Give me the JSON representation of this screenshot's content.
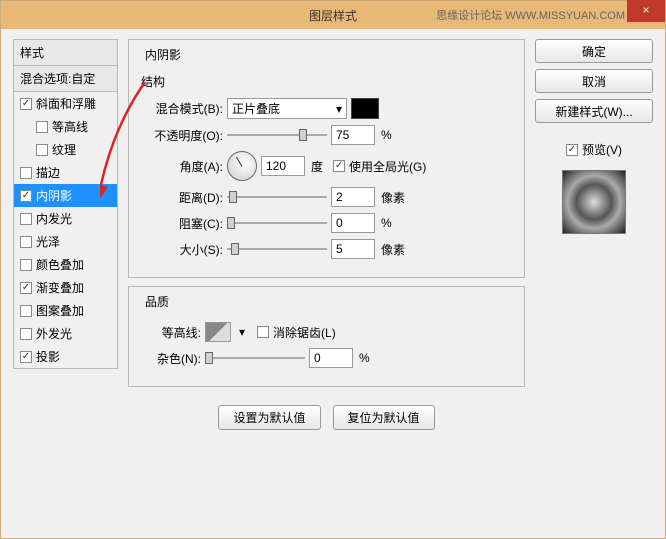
{
  "title": "图层样式",
  "watermark": "思缘设计论坛 WWW.MISSYUAN.COM",
  "left": {
    "header": "样式",
    "sub": "混合选项:自定",
    "items": [
      {
        "label": "斜面和浮雕",
        "checked": true,
        "indent": false
      },
      {
        "label": "等高线",
        "checked": false,
        "indent": true
      },
      {
        "label": "纹理",
        "checked": false,
        "indent": true
      },
      {
        "label": "描边",
        "checked": false,
        "indent": false
      },
      {
        "label": "内阴影",
        "checked": true,
        "indent": false,
        "selected": true
      },
      {
        "label": "内发光",
        "checked": false,
        "indent": false
      },
      {
        "label": "光泽",
        "checked": false,
        "indent": false
      },
      {
        "label": "颜色叠加",
        "checked": false,
        "indent": false
      },
      {
        "label": "渐变叠加",
        "checked": true,
        "indent": false
      },
      {
        "label": "图案叠加",
        "checked": false,
        "indent": false
      },
      {
        "label": "外发光",
        "checked": false,
        "indent": false
      },
      {
        "label": "投影",
        "checked": true,
        "indent": false
      }
    ]
  },
  "panel": {
    "title": "内阴影",
    "sec1": "结构",
    "blend_label": "混合模式(B):",
    "blend_value": "正片叠底",
    "opacity_label": "不透明度(O):",
    "opacity_value": "75",
    "opacity_unit": "%",
    "angle_label": "角度(A):",
    "angle_value": "120",
    "angle_unit": "度",
    "global_label": "使用全局光(G)",
    "distance_label": "距离(D):",
    "distance_value": "2",
    "distance_unit": "像素",
    "choke_label": "阻塞(C):",
    "choke_value": "0",
    "choke_unit": "%",
    "size_label": "大小(S):",
    "size_value": "5",
    "size_unit": "像素",
    "sec2": "品质",
    "contour_label": "等高线:",
    "aa_label": "消除锯齿(L)",
    "noise_label": "杂色(N):",
    "noise_value": "0",
    "noise_unit": "%",
    "def_btn": "设置为默认值",
    "reset_btn": "复位为默认值"
  },
  "right": {
    "ok": "确定",
    "cancel": "取消",
    "newstyle": "新建样式(W)...",
    "preview": "预览(V)"
  }
}
